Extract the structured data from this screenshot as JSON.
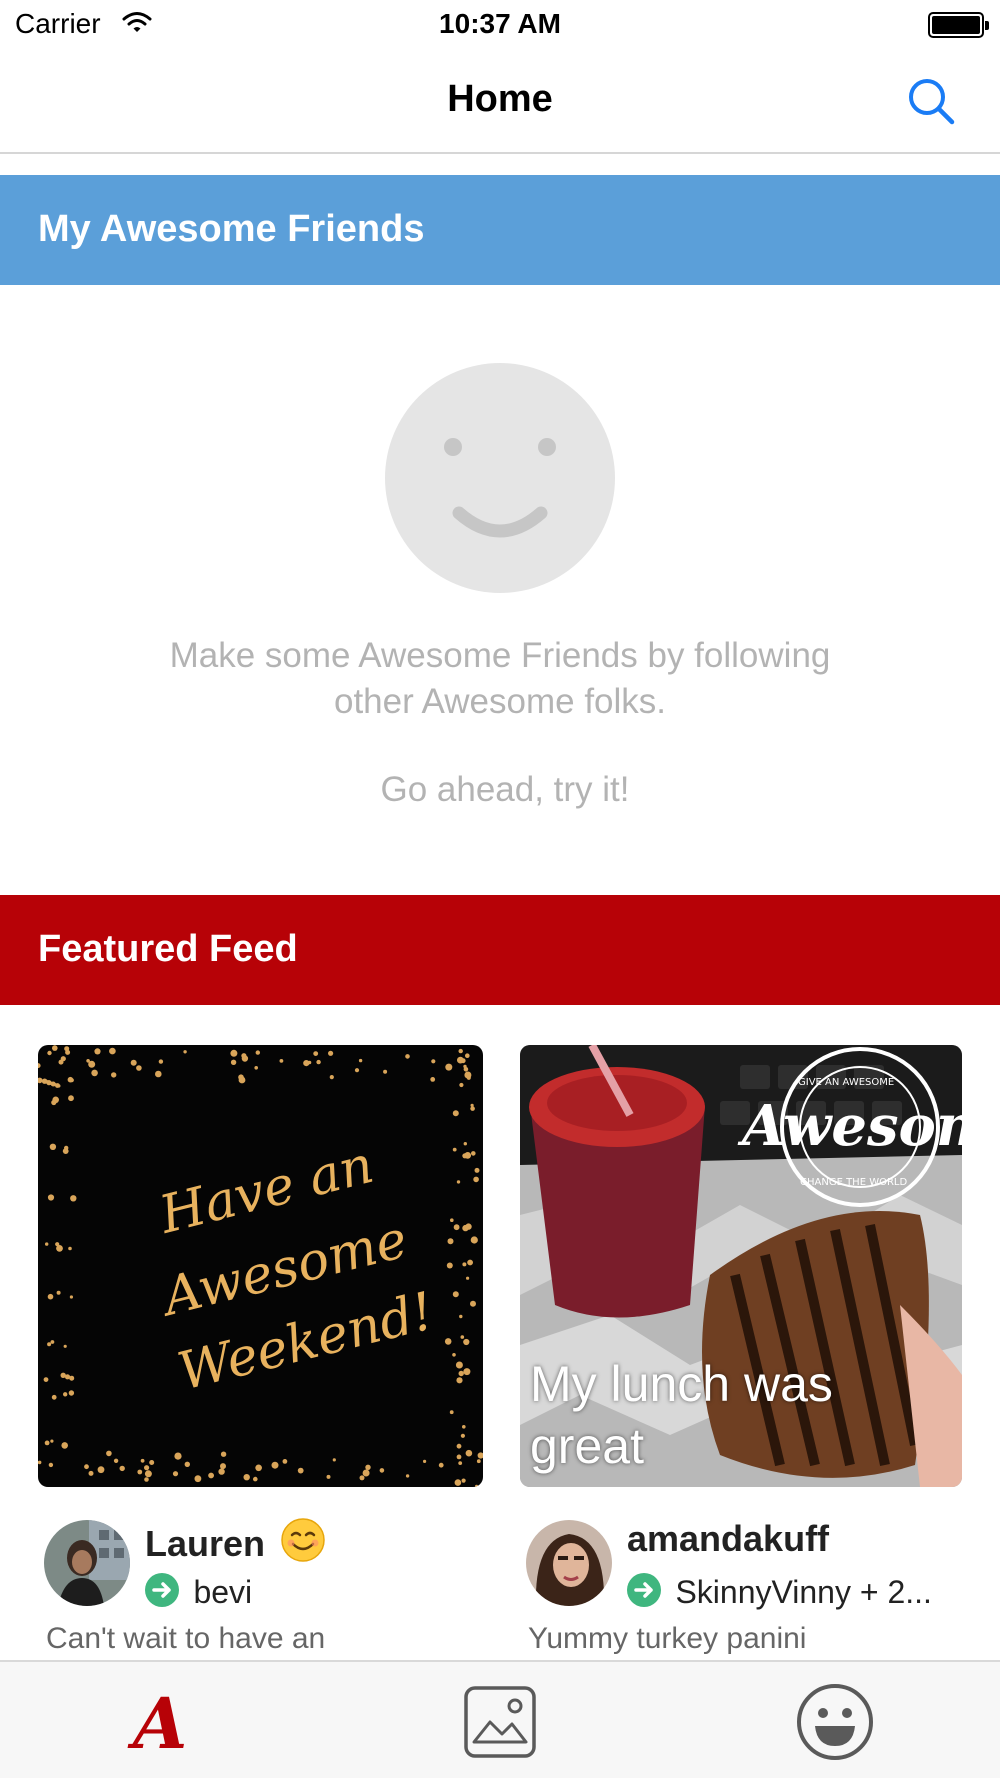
{
  "status_bar": {
    "carrier": "Carrier",
    "time": "10:37 AM",
    "icons": [
      "wifi-icon",
      "battery-icon"
    ]
  },
  "nav": {
    "title": "Home",
    "search_icon": "search-icon",
    "accent_color": "#1a7cf5"
  },
  "friends_section": {
    "header": "My Awesome Friends",
    "header_color": "#5b9fd9",
    "empty_icon": "smiley-face-icon",
    "empty_message": "Make some Awesome Friends by following other Awesome folks.",
    "empty_cta": "Go ahead, try it!"
  },
  "featured_section": {
    "header": "Featured Feed",
    "header_color": "#b70207",
    "cards": [
      {
        "image_text_lines": [
          "Have an",
          "Awesome",
          "Weekend!"
        ],
        "username": "Lauren",
        "name_emoji": "smiling-face-emoji",
        "via": "bevi",
        "caption": "Can't wait to have an"
      },
      {
        "image_overlay_text": "My lunch was great",
        "image_stamp_text": "Awesome",
        "image_stamp_ring_top": "GIVE AN AWESOME",
        "image_stamp_ring_bottom": "CHANGE THE WORLD",
        "username": "amandakuff",
        "via": "SkinnyVinny + 2...",
        "caption": "Yummy turkey panini"
      }
    ]
  },
  "tab_bar": {
    "tabs": [
      {
        "name": "home",
        "icon": "awesome-logo-icon",
        "active": true,
        "color": "#b70207"
      },
      {
        "name": "photos",
        "icon": "photo-icon",
        "active": false
      },
      {
        "name": "profile",
        "icon": "smiley-icon",
        "active": false
      }
    ]
  }
}
